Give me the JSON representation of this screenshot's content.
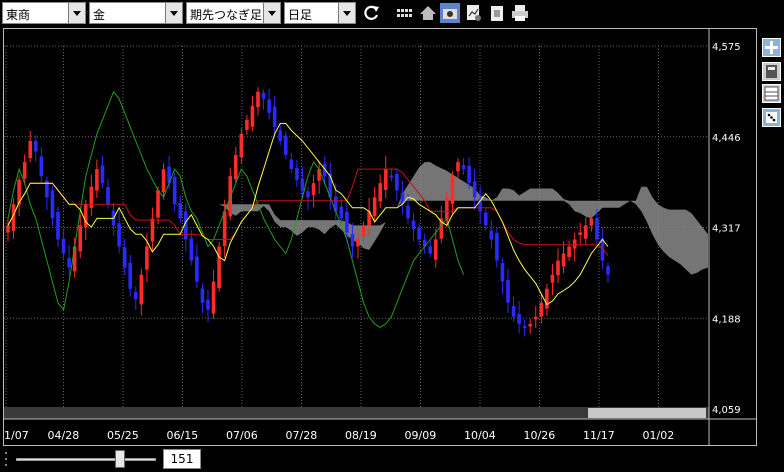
{
  "toolbar": {
    "exchange": "東商",
    "commodity": "金",
    "contract": "期先つなぎ足",
    "period": "日足",
    "icons": [
      "refresh-icon",
      "bars-icon",
      "home-icon",
      "camera-icon",
      "chart-settings-icon",
      "copy-icon",
      "print-icon"
    ]
  },
  "side_toolbar": {
    "icons": [
      "crosshair-icon",
      "calculator-icon",
      "grid-icon",
      "dice-icon"
    ]
  },
  "bottom": {
    "count": "151",
    "slider_fraction": 0.74
  },
  "colors": {
    "up": "#ff2a2a",
    "down": "#2a2aff",
    "cloud": "#8a8a8a",
    "tenkan": "#ffff40",
    "kijun": "#cc1010",
    "chikou": "#20a020",
    "grid": "#666666",
    "axis_text": "#ffffff"
  },
  "chart_data": {
    "type": "candlestick",
    "title": "",
    "xlabel": "",
    "ylabel": "",
    "ylim": [
      4059,
      4575
    ],
    "yticks": [
      "4,575",
      "4,446",
      "4,317",
      "4,188",
      "4,059"
    ],
    "ytick_values": [
      4575,
      4446,
      4317,
      4188,
      4059
    ],
    "xticks": [
      "1/07",
      "04/28",
      "05/25",
      "06/15",
      "07/06",
      "07/28",
      "08/19",
      "09/09",
      "10/04",
      "10/26",
      "11/17",
      "01/02"
    ],
    "grid": true,
    "candles": [
      4320,
      4350,
      4385,
      4410,
      4440,
      4425,
      4390,
      4360,
      4330,
      4300,
      4280,
      4260,
      4290,
      4320,
      4350,
      4375,
      4400,
      4380,
      4350,
      4320,
      4290,
      4260,
      4230,
      4215,
      4250,
      4290,
      4330,
      4370,
      4400,
      4380,
      4350,
      4330,
      4300,
      4270,
      4240,
      4210,
      4200,
      4240,
      4290,
      4340,
      4390,
      4420,
      4450,
      4470,
      4490,
      4510,
      4500,
      4480,
      4460,
      4440,
      4420,
      4400,
      4385,
      4370,
      4360,
      4380,
      4400,
      4390,
      4360,
      4340,
      4330,
      4310,
      4290,
      4300,
      4320,
      4340,
      4360,
      4380,
      4400,
      4390,
      4370,
      4350,
      4330,
      4315,
      4300,
      4290,
      4280,
      4300,
      4330,
      4360,
      4390,
      4410,
      4400,
      4380,
      4360,
      4340,
      4320,
      4300,
      4270,
      4240,
      4210,
      4190,
      4180,
      4175,
      4180,
      4190,
      4210,
      4230,
      4250,
      4270,
      4280,
      4290,
      4300,
      4310,
      4320,
      4330,
      4300,
      4270,
      4250
    ]
  }
}
